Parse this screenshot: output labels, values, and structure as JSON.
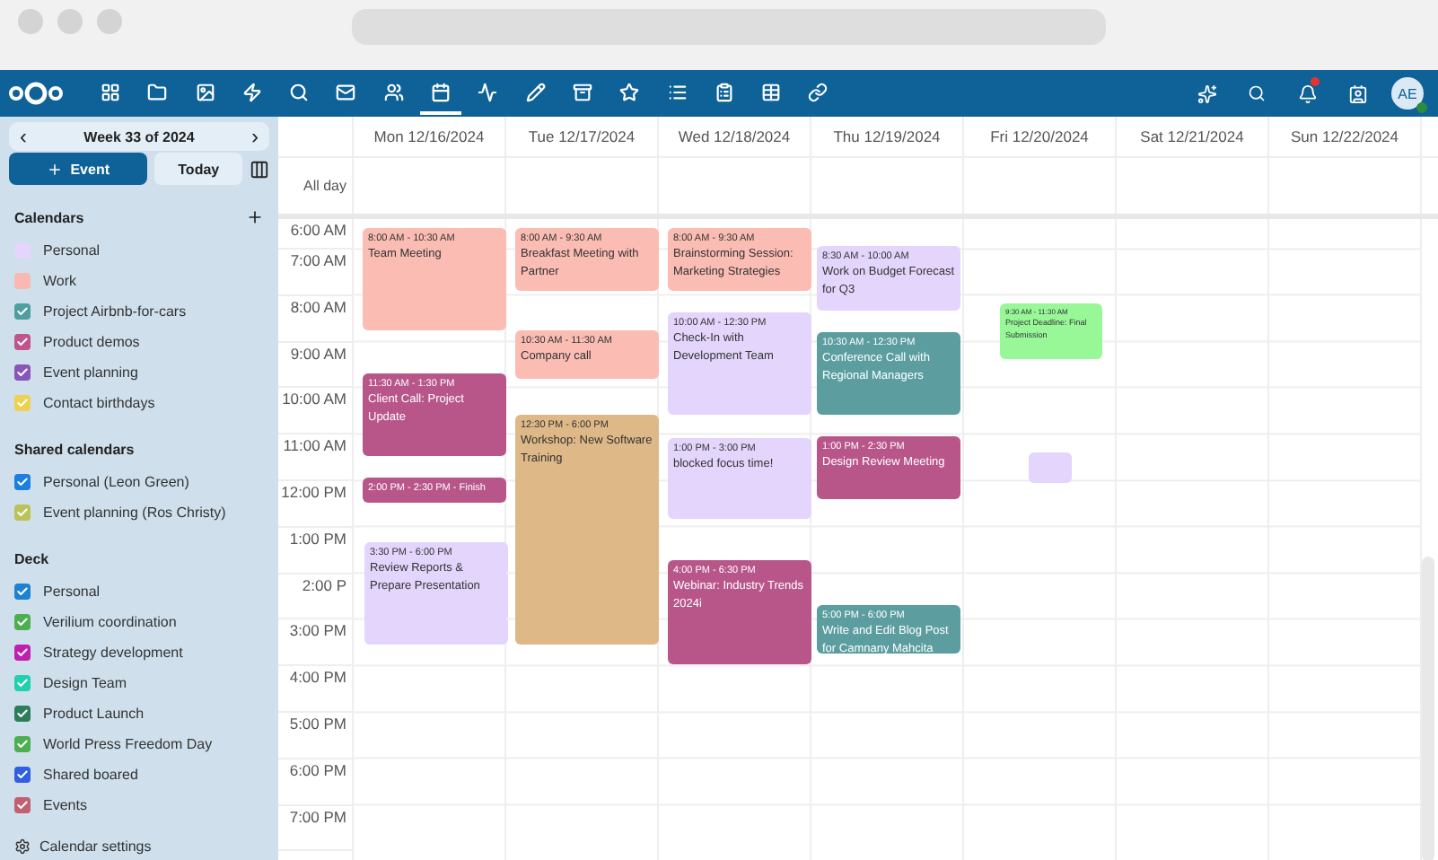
{
  "apps": [
    {
      "selected": false
    },
    {
      "selected": false
    },
    {
      "selected": false
    },
    {
      "selected": false
    },
    {
      "selected": false
    },
    {
      "selected": false
    },
    {
      "selected": false
    },
    {
      "selected": true
    },
    {
      "selected": false
    },
    {
      "selected": false
    },
    {
      "selected": false
    },
    {
      "selected": false
    },
    {
      "selected": false
    },
    {
      "selected": false
    },
    {
      "selected": false
    },
    {
      "selected": false
    }
  ],
  "header_right": {
    "avatar": "AE",
    "has_notification": true
  },
  "sidebar": {
    "week_label": "Week 33 of 2024",
    "prev": "‹",
    "next": "›",
    "new_event": "Event",
    "today": "Today",
    "sections": [
      {
        "title": "Calendars",
        "can_add": true,
        "items": [
          {
            "name": "Personal",
            "color": "#e3d5fb",
            "checked": false
          },
          {
            "name": "Work",
            "color": "#f9b8b0",
            "checked": false
          },
          {
            "name": "Project Airbnb-for-cars",
            "color": "#4f9fa0",
            "checked": true
          },
          {
            "name": "Product demos",
            "color": "#c0548c",
            "checked": true
          },
          {
            "name": "Event planning",
            "color": "#8a55b8",
            "checked": true
          },
          {
            "name": "Contact birthdays",
            "color": "#f0d050",
            "checked": true
          }
        ]
      },
      {
        "title": "Shared calendars",
        "can_add": false,
        "items": [
          {
            "name": "Personal (Leon Green)",
            "color": "#1b7ee0",
            "checked": true
          },
          {
            "name": "Event planning (Ros Christy)",
            "color": "#b9c35a",
            "checked": true
          }
        ]
      },
      {
        "title": "Deck",
        "can_add": false,
        "items": [
          {
            "name": "Personal",
            "color": "#1e82d0",
            "checked": true
          },
          {
            "name": "Verilium coordination",
            "color": "#4caf50",
            "checked": true
          },
          {
            "name": "Strategy development",
            "color": "#c020b0",
            "checked": true
          },
          {
            "name": "Design Team",
            "color": "#20d0b0",
            "checked": true
          },
          {
            "name": "Product Launch",
            "color": "#2e7d5a",
            "checked": true
          },
          {
            "name": "World Press Freedom Day",
            "color": "#4caf50",
            "checked": true
          },
          {
            "name": "Shared boared",
            "color": "#3060e0",
            "checked": true
          },
          {
            "name": "Events",
            "color": "#c06070",
            "checked": true
          }
        ]
      }
    ],
    "settings": "Calendar settings"
  },
  "calendar": {
    "all_day": "All day",
    "hours": [
      "6:00 AM",
      "7:00 AM",
      "8:00 AM",
      "9:00 AM",
      "10:00 AM",
      "11:00 AM",
      "12:00 PM",
      "1:00 PM",
      "2:00 P",
      "3:00 PM",
      "4:00 PM",
      "5:00 PM",
      "6:00 PM",
      "7:00 PM"
    ],
    "days": [
      {
        "label": "Mon 12/16/2024",
        "events": [
          {
            "time": "8:00 AM - 10:30 AM",
            "title": "Team Meeting",
            "color": "#fbbcb4"
          },
          {
            "time": "11:30 AM - 1:30 PM",
            "title": "Client Call: Project Update",
            "color": "#b8568a"
          },
          {
            "time": "2:00 PM - 2:30 PM - Finish",
            "color": "#b8568a"
          },
          {
            "time": "3:30 PM - 6:00 PM",
            "title": "Review Reports & Prepare Presentation",
            "color": "#e3d5fb"
          }
        ]
      },
      {
        "label": "Tue 12/17/2024",
        "events": [
          {
            "time": "8:00 AM - 9:30 AM",
            "title": "Breakfast Meeting with Partner",
            "color": "#fbbcb4"
          },
          {
            "time": "10:30 AM - 11:30 AM",
            "title": "Company call",
            "color": "#fbbcb4"
          },
          {
            "time": "12:30 PM - 6:00 PM",
            "title": "Workshop: New Software Training",
            "color": "#deb887"
          }
        ]
      },
      {
        "label": "Wed 12/18/2024",
        "events": [
          {
            "time": "8:00 AM - 9:30 AM",
            "title": "Brainstorming Session: Marketing Strategies",
            "color": "#fbbcb4"
          },
          {
            "time": "10:00 AM - 12:30 PM",
            "title": "Check-In with Development Team",
            "color": "#e3d5fb"
          },
          {
            "time": "1:00 PM - 3:00 PM",
            "title": "blocked focus time!",
            "color": "#e3d5fb"
          },
          {
            "time": "4:00 PM - 6:30 PM",
            "title": "Webinar: Industry Trends 2024i",
            "color": "#b8568a"
          }
        ]
      },
      {
        "label": "Thu 12/19/2024",
        "events": [
          {
            "time": "8:30 AM - 10:00 AM",
            "title": "Work on Budget Forecast for Q3",
            "color": "#e3d5fb"
          },
          {
            "time": "10:30 AM - 12:30 PM",
            "title": "Conference Call with Regional Managers",
            "color": "#5c9ea0"
          },
          {
            "time": "1:00 PM - 2:30 PM",
            "title": "Design Review Meeting",
            "color": "#b8568a"
          },
          {
            "time": "5:00 PM - 6:00 PM",
            "title": "Write and Edit Blog Post for Camnany Mahcita",
            "color": "#5c9ea0"
          }
        ]
      },
      {
        "label": "Fri 12/20/2024",
        "events": [
          {
            "time": "9:30 AM - 11:30 AM",
            "title": "Project Deadline: Final Submission",
            "color": "#98f898"
          },
          {
            "color": "#e3d5fb"
          }
        ]
      },
      {
        "label": "Sat 12/21/2024"
      },
      {
        "label": "Sun 12/22/2024"
      }
    ]
  }
}
